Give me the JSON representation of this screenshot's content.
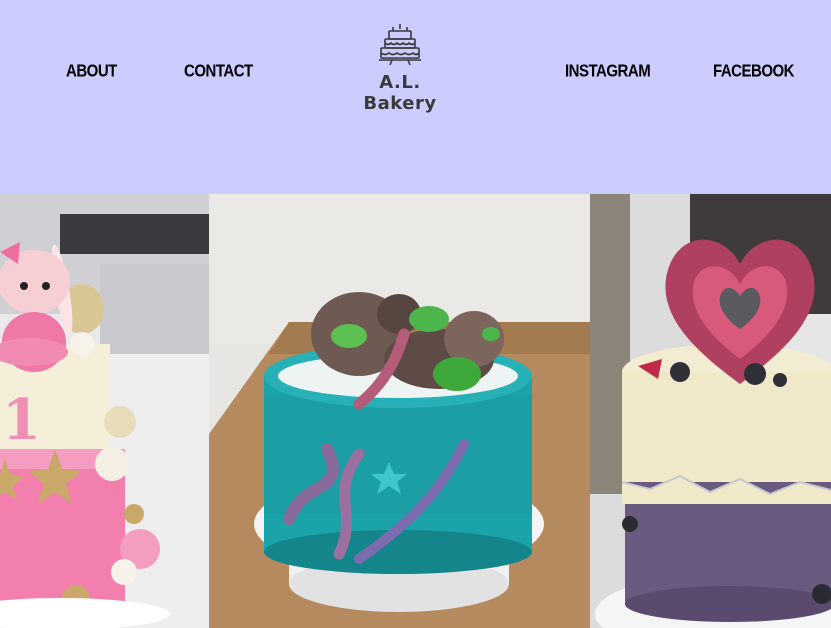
{
  "nav": {
    "about": "ABOUT",
    "contact": "CONTACT",
    "instagram": "INSTAGRAM",
    "facebook": "FACEBOOK"
  },
  "logo": {
    "name": "A.L. Bakery",
    "icon": "cake-icon"
  },
  "colors": {
    "header_bg": "#ccccff",
    "text": "#000000"
  },
  "gallery": {
    "items": [
      {
        "label": "photo-pink-bunny-cake"
      },
      {
        "label": "photo-ocean-octopus-cake"
      },
      {
        "label": "photo-heart-geode-cake"
      }
    ]
  }
}
